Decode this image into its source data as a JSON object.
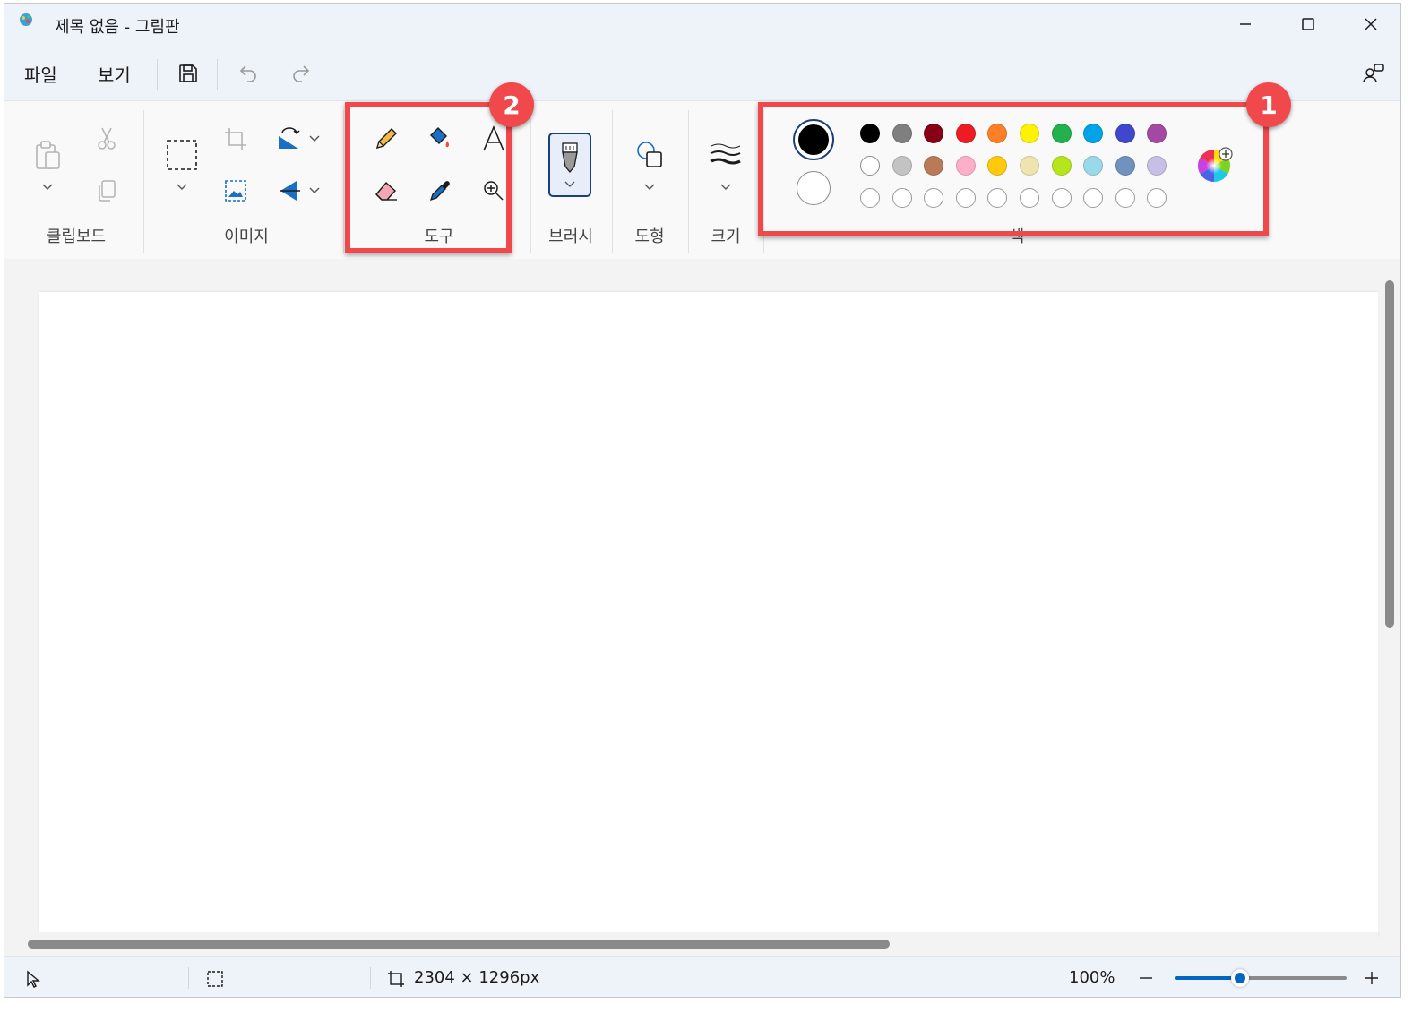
{
  "window": {
    "title": "제목 없음 - 그림판"
  },
  "menu": {
    "file": "파일",
    "view": "보기"
  },
  "ribbon": {
    "groups": {
      "clipboard": "클립보드",
      "image": "이미지",
      "tools": "도구",
      "brush": "브러시",
      "shapes": "도형",
      "size": "크기",
      "colors": "색"
    }
  },
  "colors": {
    "primary": "#000000",
    "secondary": "#ffffff",
    "palette_row1": [
      "#000000",
      "#7f7f7f",
      "#880015",
      "#ed1c24",
      "#ff7f27",
      "#fff200",
      "#22b14c",
      "#00a2e8",
      "#3f48cc",
      "#a349a4"
    ],
    "palette_row2": [
      "#ffffff",
      "#c3c3c3",
      "#b97a57",
      "#ffaec9",
      "#ffc90e",
      "#efe4b0",
      "#b5e61d",
      "#99d9ea",
      "#7092be",
      "#c8bfe7"
    ],
    "custom_row_count_label": ""
  },
  "annotations": {
    "callout1": "1",
    "callout2": "2",
    "accent": "#f0484b"
  },
  "status": {
    "dimensions": "2304 × 1296px",
    "zoom": "100%",
    "zoom_fraction": 0.38
  }
}
